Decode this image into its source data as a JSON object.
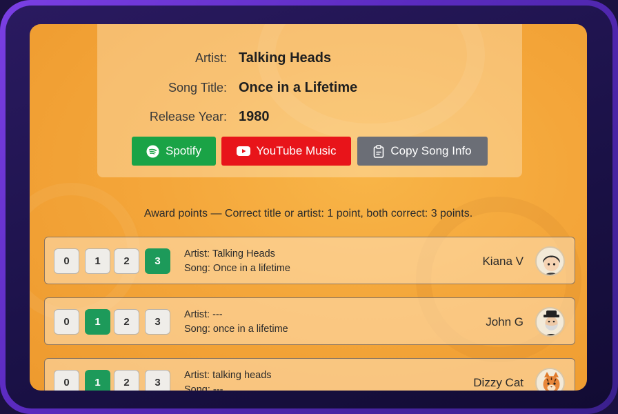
{
  "song": {
    "artist_label": "Artist:",
    "artist_value": "Talking Heads",
    "title_label": "Song Title:",
    "title_value": "Once in a Lifetime",
    "year_label": "Release Year:",
    "year_value": "1980"
  },
  "buttons": {
    "spotify": {
      "label": "Spotify",
      "icon": "spotify-icon",
      "color": "#1aa346"
    },
    "youtube": {
      "label": "YouTube Music",
      "icon": "youtube-icon",
      "color": "#e8141a"
    },
    "copy": {
      "label": "Copy Song Info",
      "icon": "clipboard-icon",
      "color": "#6b6e76"
    }
  },
  "award_text": "Award points — Correct title or artist: 1 point, both correct: 3 points.",
  "score_options": [
    "0",
    "1",
    "2",
    "3"
  ],
  "selected_color": "#1d9a5a",
  "players": [
    {
      "name": "Kiana V",
      "artist_guess": "Artist: Talking Heads",
      "song_guess": "Song: Once in a lifetime",
      "selected_score": 3,
      "avatar": "anime-boy-avatar"
    },
    {
      "name": "John G",
      "artist_guess": "Artist: ---",
      "song_guess": "Song: once in a lifetime",
      "selected_score": 1,
      "avatar": "bearded-man-avatar"
    },
    {
      "name": "Dizzy Cat",
      "artist_guess": "Artist: talking heads",
      "song_guess": "Song: ---",
      "selected_score": 1,
      "avatar": "tiger-cat-avatar"
    }
  ]
}
